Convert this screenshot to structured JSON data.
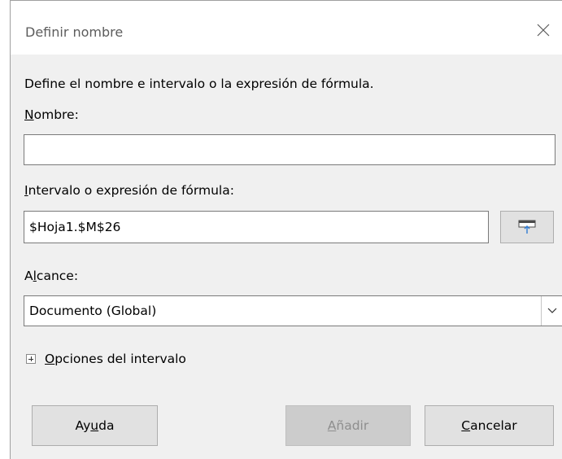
{
  "window": {
    "title": "Definir nombre",
    "close_icon": "close-icon"
  },
  "description": "Define el nombre e intervalo o la expresión de fórmula.",
  "name_field": {
    "label_prefix": "",
    "label_mnemonic": "N",
    "label_rest": "ombre:",
    "value": ""
  },
  "range_field": {
    "label_prefix": "",
    "label_mnemonic": "I",
    "label_rest": "ntervalo o expresión de fórmula:",
    "value": "$Hoja1.$M$26",
    "shrink_button_icon": "shrink-reference-icon"
  },
  "scope_field": {
    "label_prefix": "A",
    "label_mnemonic": "l",
    "label_rest": "cance:",
    "selected": "Documento (Global)",
    "arrow_icon": "chevron-down-icon"
  },
  "range_options": {
    "expander_icon": "expand-plus-icon",
    "label_mnemonic": "O",
    "label_rest": "pciones del intervalo"
  },
  "buttons": {
    "help": {
      "prefix": "Ay",
      "mnemonic": "u",
      "rest": "da"
    },
    "add": {
      "prefix": "",
      "mnemonic": "A",
      "rest": "ñadir",
      "enabled": false
    },
    "cancel": {
      "prefix": "",
      "mnemonic": "C",
      "rest": "ancelar"
    }
  },
  "colors": {
    "dialog_bg": "#f0f0f0",
    "titlebar_bg": "#ffffff",
    "button_bg": "#e1e1e1",
    "disabled_text": "#8e8e8e",
    "ref_icon_blue": "#2f7bd3"
  }
}
